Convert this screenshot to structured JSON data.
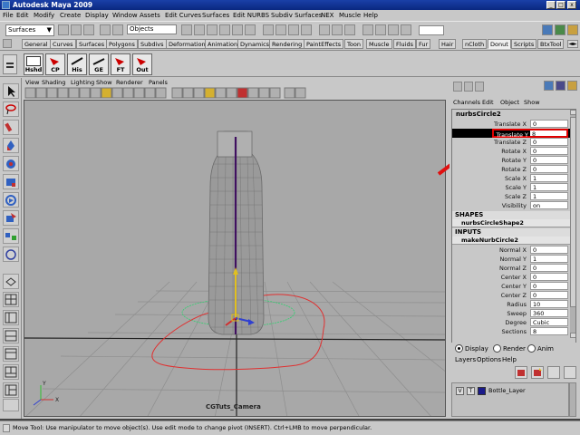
{
  "app": {
    "title": "Autodesk Maya 2009"
  },
  "menubar": [
    "File",
    "Edit",
    "Modify",
    "Create",
    "Display",
    "Window",
    "Assets",
    "Edit Curves",
    "Surfaces",
    "Edit NURBS",
    "Subdiv Surfaces",
    "NEX",
    "Muscle",
    "Help"
  ],
  "statusline": {
    "menu_set": "Surfaces",
    "select_mode": "Objects"
  },
  "shelf_tabs": [
    "General",
    "Curves",
    "Surfaces",
    "Polygons",
    "Subdivs",
    "Deformation",
    "Animation",
    "Dynamics",
    "Rendering",
    "PaintEffects",
    "Toon",
    "Muscle",
    "Fluids",
    "Fur",
    "Hair",
    "nCloth",
    "Donut",
    "Scripts",
    "BtxTool"
  ],
  "shelf_active": "Donut",
  "shelf_buttons": [
    "Hshd",
    "CP",
    "His",
    "GE",
    "FT",
    "Out"
  ],
  "viewport": {
    "menu": [
      "View",
      "Shading",
      "Lighting",
      "Show",
      "Renderer",
      "Panels"
    ],
    "camera_label": "CGTuts_Camera",
    "axis_x": "X",
    "axis_y": "Y"
  },
  "channel_box": {
    "menu": [
      "Channels",
      "Edit",
      "Object",
      "Show"
    ],
    "node": "nurbsCircle2",
    "attributes": [
      {
        "name": "Translate X",
        "value": "0"
      },
      {
        "name": "Translate Y",
        "value": "8"
      },
      {
        "name": "Translate Z",
        "value": "0"
      },
      {
        "name": "Rotate X",
        "value": "0"
      },
      {
        "name": "Rotate Y",
        "value": "0"
      },
      {
        "name": "Rotate Z",
        "value": "0"
      },
      {
        "name": "Scale X",
        "value": "1"
      },
      {
        "name": "Scale Y",
        "value": "1"
      },
      {
        "name": "Scale Z",
        "value": "1"
      },
      {
        "name": "Visibility",
        "value": "on"
      }
    ],
    "shapes_header": "SHAPES",
    "shape_node": "nurbsCircleShape2",
    "inputs_header": "INPUTS",
    "input_node": "makeNurbCircle2",
    "input_attributes": [
      {
        "name": "Normal X",
        "value": "0"
      },
      {
        "name": "Normal Y",
        "value": "1"
      },
      {
        "name": "Normal Z",
        "value": "0"
      },
      {
        "name": "Center X",
        "value": "0"
      },
      {
        "name": "Center Y",
        "value": "0"
      },
      {
        "name": "Center Z",
        "value": "0"
      },
      {
        "name": "Radius",
        "value": "10"
      },
      {
        "name": "Sweep",
        "value": "360"
      },
      {
        "name": "Degree",
        "value": "Cubic"
      },
      {
        "name": "Sections",
        "value": "8"
      }
    ]
  },
  "layer_editor": {
    "modes": [
      "Display",
      "Render",
      "Anim"
    ],
    "menu": [
      "Layers",
      "Options",
      "Help"
    ],
    "layer": {
      "v": "V",
      "t": "T",
      "name": "Bottle_Layer"
    }
  },
  "helpline": "Move Tool: Use manipulator to move object(s). Use edit mode to change pivot (INSERT). Ctrl+LMB to move perpendicular.",
  "colors": {
    "highlight": "#e00000",
    "selected_row": "#000000",
    "viewport_bg": "#a8a8a8"
  }
}
